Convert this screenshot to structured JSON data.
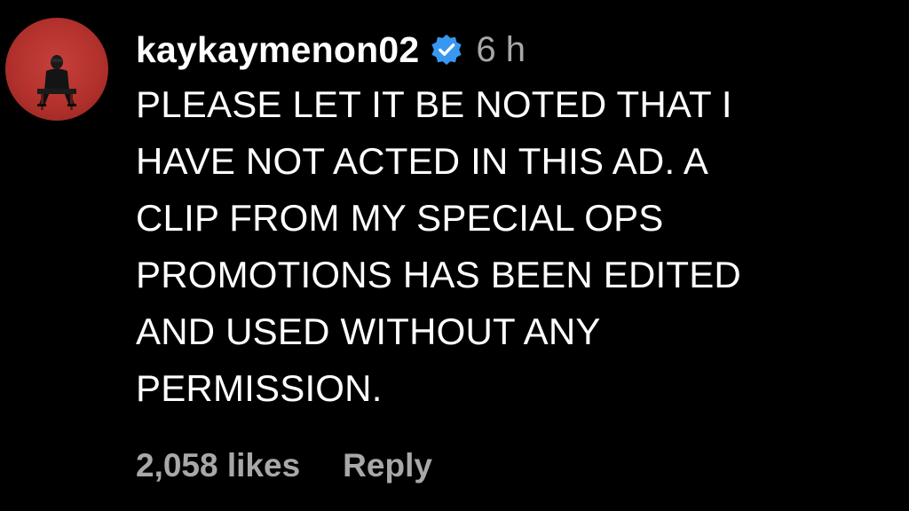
{
  "comment": {
    "username": "kaykaymenon02",
    "verified_icon": "verified-badge-icon",
    "timestamp": "6 h",
    "text": "PLEASE LET IT BE NOTED THAT I\nHAVE NOT ACTED IN THIS AD. A\nCLIP FROM MY SPECIAL OPS\nPROMOTIONS HAS BEEN EDITED\nAND USED WITHOUT ANY\nPERMISSION.",
    "likes": "2,058 likes",
    "reply_label": "Reply"
  },
  "colors": {
    "background": "#000000",
    "text": "#ffffff",
    "secondary_text": "#a8a8a8",
    "verified_blue": "#3897f0",
    "avatar_red": "#b3312d"
  }
}
